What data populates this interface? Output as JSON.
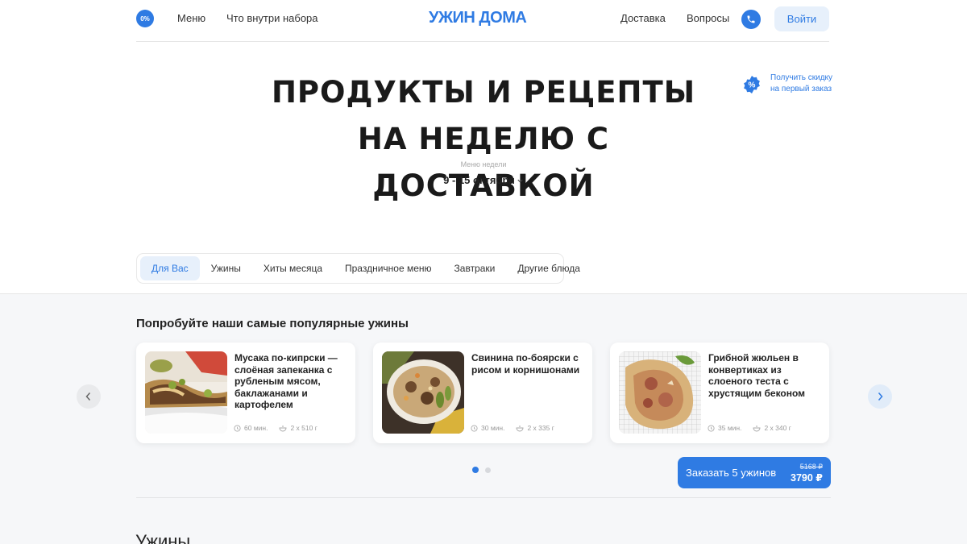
{
  "header": {
    "badge": "0%",
    "nav_left": [
      "Меню",
      "Что внутри набора"
    ],
    "logo": "УЖИН ДОМА",
    "nav_right": [
      "Доставка",
      "Вопросы"
    ],
    "phone_icon": "phone-icon",
    "login_label": "Войти"
  },
  "hero": {
    "title_line1": "Продукты и рецепты",
    "title_line2": "на неделю с доставкой",
    "discount_line1": "Получить скидку",
    "discount_line2": "на первый заказ",
    "discount_icon": "percent-badge-icon",
    "week_label": "Меню недели",
    "week_range": "9 - 15 октября"
  },
  "tabs": [
    {
      "label": "Для Вас",
      "active": true
    },
    {
      "label": "Ужины",
      "active": false
    },
    {
      "label": "Хиты месяца",
      "active": false
    },
    {
      "label": "Праздничное меню",
      "active": false
    },
    {
      "label": "Завтраки",
      "active": false
    },
    {
      "label": "Другие блюда",
      "active": false
    }
  ],
  "popular": {
    "title": "Попробуйте наши самые популярные ужины",
    "cards": [
      {
        "title": "Мусака по-кипрски — слоёная запеканка с рубленым мясом, баклажанами и картофелем",
        "time": "60 мин.",
        "portion": "2 х 510 г"
      },
      {
        "title": "Свинина по-боярски с рисом и корнишонами",
        "time": "30 мин.",
        "portion": "2 х 335 г"
      },
      {
        "title": "Грибной жюльен в конвертиках из слоеного теста с хрустящим беконом",
        "time": "35 мин.",
        "portion": "2 х 340 г"
      }
    ],
    "pagination": {
      "current": 1,
      "total": 2
    },
    "order": {
      "label": "Заказать 5 ужинов",
      "old_price": "5168 ₽",
      "new_price": "3790 ₽"
    }
  },
  "next_section_title": "Ужины",
  "colors": {
    "accent": "#2f7be3",
    "accent_light": "#e7f0fb",
    "section_bg": "#f6f7f9"
  }
}
